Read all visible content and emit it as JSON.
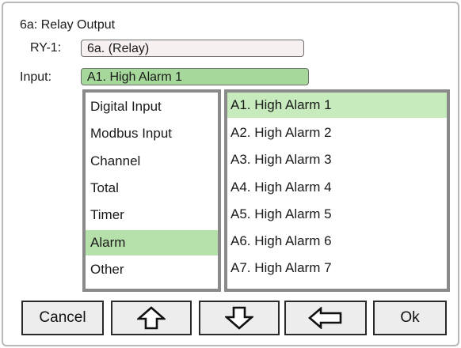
{
  "header": {
    "title": "6a: Relay Output"
  },
  "form": {
    "ry_label": "RY-1:",
    "ry_value": "6a. (Relay)",
    "input_label": "Input:",
    "input_value": "A1. High Alarm 1"
  },
  "categories": {
    "items": [
      {
        "label": "Digital Input"
      },
      {
        "label": "Modbus Input"
      },
      {
        "label": "Channel"
      },
      {
        "label": "Total"
      },
      {
        "label": "Timer"
      },
      {
        "label": "Alarm"
      },
      {
        "label": "Other"
      }
    ],
    "selected": "Alarm"
  },
  "alarms": {
    "items": [
      {
        "label": "A1. High Alarm 1"
      },
      {
        "label": "A2. High Alarm 2"
      },
      {
        "label": "A3. High Alarm 3"
      },
      {
        "label": "A4. High Alarm 4"
      },
      {
        "label": "A5. High Alarm 5"
      },
      {
        "label": "A6. High Alarm 6"
      },
      {
        "label": "A7. High Alarm 7"
      }
    ],
    "selected": "A1. High Alarm 1"
  },
  "buttons": {
    "cancel_label": "Cancel",
    "up_icon": "up-arrow-icon",
    "down_icon": "down-arrow-icon",
    "back_icon": "left-arrow-icon",
    "ok_label": "Ok"
  },
  "colors": {
    "selected_input": "#a5d89a",
    "selected_category": "#b6e0aa",
    "selected_alarm": "#c8ebbe",
    "list_border": "#8a8a8a"
  }
}
